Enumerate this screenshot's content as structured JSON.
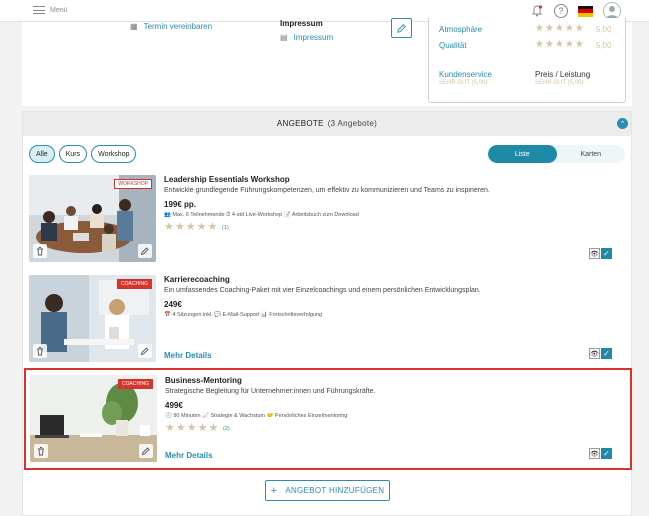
{
  "topbar": {
    "menu_label": "Menü"
  },
  "info": {
    "appointment_link": "Termin vereinbaren",
    "impressum_heading": "Impressum",
    "impressum_link": "Impressum"
  },
  "ratings": {
    "rows": [
      {
        "label": "Atmosphäre",
        "stars": "★★★★★",
        "value": "5,00"
      },
      {
        "label": "Qualität",
        "stars": "★★★★★",
        "value": "5,00"
      }
    ],
    "kundenservice_label": "Kundenservice",
    "kundenservice_value": "SEHR GUT (5,00)",
    "preis_label": "Preis / Leistung",
    "preis_value": "SEHR GUT (5,00)"
  },
  "offers": {
    "title": "ANGEBOTE",
    "count": "(3 Angebote)",
    "filters": [
      "Alle",
      "Kurs",
      "Workshop"
    ],
    "view_list": "Liste",
    "view_cards": "Karten",
    "add_button": "ANGEBOT HINZUFÜGEN",
    "items": [
      {
        "title": "Leadership Essentials Workshop",
        "description": "Entwickle grundlegende Führungskompetenzen, um effektiv zu kommunizieren und Teams zu inspirieren.",
        "price": "199€ pp.",
        "features": "👥 Max. 6 Teilnehmende ⏱ 4-std Live-Workshop 📝 Arbeitsbuch zum Download",
        "stars": "★★★★★",
        "review_count": "(1)",
        "tag": "WORKSHOP",
        "more": ""
      },
      {
        "title": "Karrierecoaching",
        "description": "Ein umfassendes Coaching-Paket mit vier Einzelcoachings und einem persönlichen Entwicklungsplan.",
        "price": "249€",
        "features": "📅 4 Sitzungen inkl. 💬 E-Mail-Support 📊 Fortschrittsverfolgung",
        "stars": "",
        "review_count": "",
        "tag": "COACHING",
        "more": "Mehr Details"
      },
      {
        "title": "Business-Mentoring",
        "description": "Strategische Begleitung für Unternehmer:innen und Führungskräfte.",
        "price": "499€",
        "features": "🕘 90 Minuten 📈 Strategie & Wachstum 🤝 Persönliches Einzelmentoring",
        "stars": "★★★★★",
        "review_count": "(2)",
        "tag": "COACHING",
        "more": "Mehr Details"
      }
    ]
  },
  "colors": {
    "accent": "#2a8eb0",
    "selected_border": "#d9342b",
    "star": "#d4c6a2"
  }
}
